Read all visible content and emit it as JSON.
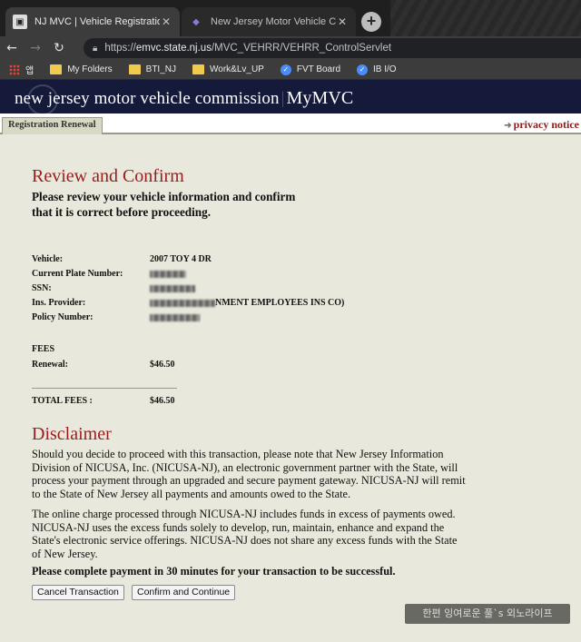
{
  "browser": {
    "tabs": [
      {
        "title": "NJ MVC | Vehicle Registration Re",
        "active": true
      },
      {
        "title": "New Jersey Motor Vehicle Comm",
        "active": false
      }
    ],
    "new_tab_glyph": "+",
    "url_host": "emvc.state.nj.us",
    "url_prefix": "https://",
    "url_path": "/MVC_VEHRR/VEHRR_ControlServlet",
    "bookmarks": [
      {
        "label": "앱",
        "icon": "apps-icon"
      },
      {
        "label": "My Folders",
        "icon": "folder-icon"
      },
      {
        "label": "BTI_NJ",
        "icon": "folder-icon"
      },
      {
        "label": "Work&Lv_UP",
        "icon": "folder-icon"
      },
      {
        "label": "FVT Board",
        "icon": "check-icon"
      },
      {
        "label": "IB I/O",
        "icon": "check-icon"
      }
    ]
  },
  "site": {
    "brand": "new jersey motor vehicle commission",
    "separator": "|",
    "product": "MyMVC",
    "tab_label": "Registration Renewal",
    "privacy_link": "privacy notice"
  },
  "page": {
    "heading": "Review and Confirm",
    "subtitle": "Please review your vehicle information and confirm that it is correct before proceeding.",
    "fields": [
      {
        "label": "Vehicle:",
        "value": "2007 TOY 4 DR"
      },
      {
        "label": "Current Plate Number:",
        "value": ""
      },
      {
        "label": "SSN:",
        "value": ""
      },
      {
        "label": "Ins. Provider:",
        "value": "NMENT EMPLOYEES INS CO)"
      },
      {
        "label": "Policy Number:",
        "value": ""
      }
    ],
    "fees_heading": "FEES",
    "renewal_label": "Renewal:",
    "renewal_value": "$46.50",
    "total_label": "TOTAL FEES :",
    "total_value": "$46.50",
    "disclaimer_heading": "Disclaimer",
    "disclaimer_p1": "Should you decide to proceed with this transaction, please note that New Jersey Information Division of NICUSA, Inc. (NICUSA-NJ), an electronic government partner with the State, will process your payment through an upgraded and secure payment gateway. NICUSA-NJ will remit to the State of New Jersey all payments and amounts owed to the State.",
    "disclaimer_p2": "The online charge processed through NICUSA-NJ includes funds in excess of payments owed. NICUSA-NJ uses the excess funds solely to develop, run, maintain, enhance and expand the State's electronic service offerings. NICUSA-NJ does not share any excess funds with the State of New Jersey.",
    "warning": "Please complete payment in 30 minutes for your transaction to be successful.",
    "cancel_button": "Cancel Transaction",
    "confirm_button": "Confirm and Continue"
  },
  "watermark": "한편 잉여로운 풀`s 외노라이프"
}
